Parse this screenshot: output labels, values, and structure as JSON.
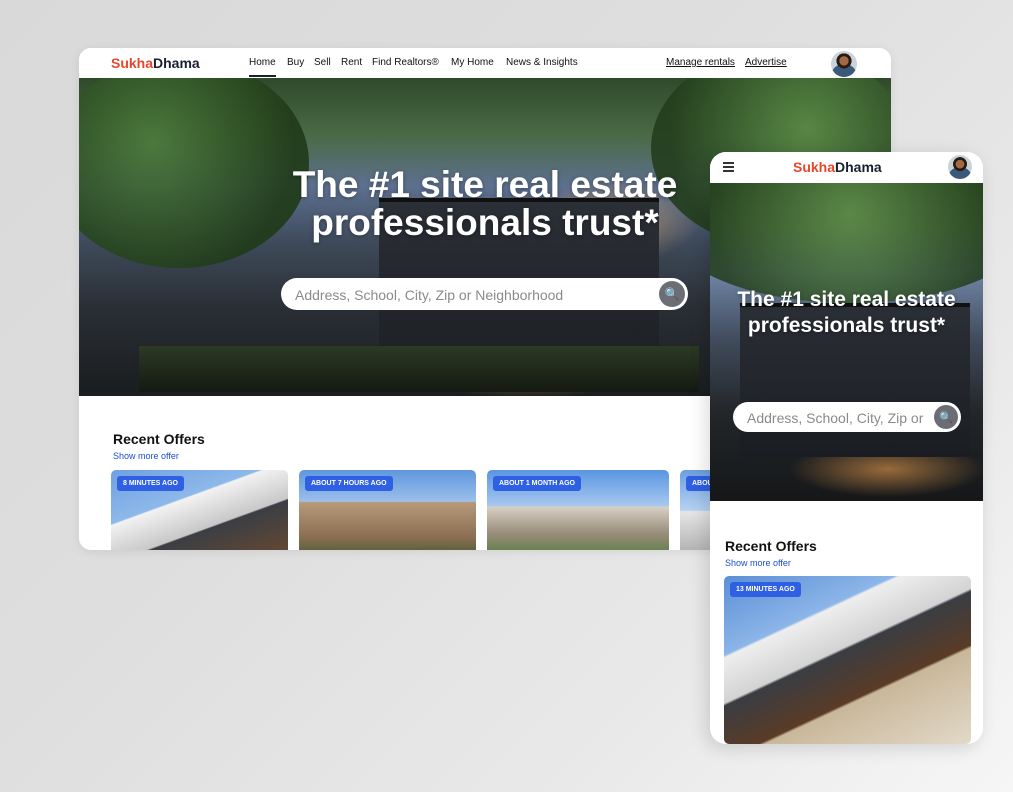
{
  "brand": {
    "logo_part1": "Sukha",
    "logo_part2": "Dhama"
  },
  "desktop": {
    "nav": {
      "items": [
        {
          "label": "Home",
          "active": true
        },
        {
          "label": "Buy"
        },
        {
          "label": "Sell"
        },
        {
          "label": "Rent"
        },
        {
          "label": "Find Realtors®"
        },
        {
          "label": "My Home"
        },
        {
          "label": "News & Insights"
        }
      ],
      "links": [
        {
          "label": "Manage rentals"
        },
        {
          "label": "Advertise"
        }
      ]
    },
    "hero": {
      "headline_line1": "The #1 site real estate",
      "headline_line2": "professionals trust*",
      "search_placeholder": "Address, School, City, Zip or Neighborhood"
    },
    "recent_offers": {
      "title": "Recent Offers",
      "show_more": "Show more offer",
      "cards": [
        {
          "badge": "8 MINUTES AGO"
        },
        {
          "badge": "ABOUT 7 HOURS AGO"
        },
        {
          "badge": "ABOUT 1 MONTH AGO"
        },
        {
          "badge": "ABOU"
        }
      ]
    }
  },
  "mobile": {
    "hero": {
      "headline_line1": "The #1 site real estate",
      "headline_line2": "professionals trust*",
      "search_placeholder": "Address, School, City, Zip or Neighborhood"
    },
    "recent_offers": {
      "title": "Recent Offers",
      "show_more": "Show more offer",
      "cards": [
        {
          "badge": "13 MINUTES AGO"
        }
      ]
    }
  },
  "icons": {
    "search": "search-icon",
    "menu": "hamburger-menu-icon",
    "avatar": "user-avatar"
  },
  "colors": {
    "brand_accent": "#e8462a",
    "brand_dark": "#17212f",
    "badge_blue": "#2f5fe3",
    "link_blue": "#1a4ed8"
  }
}
